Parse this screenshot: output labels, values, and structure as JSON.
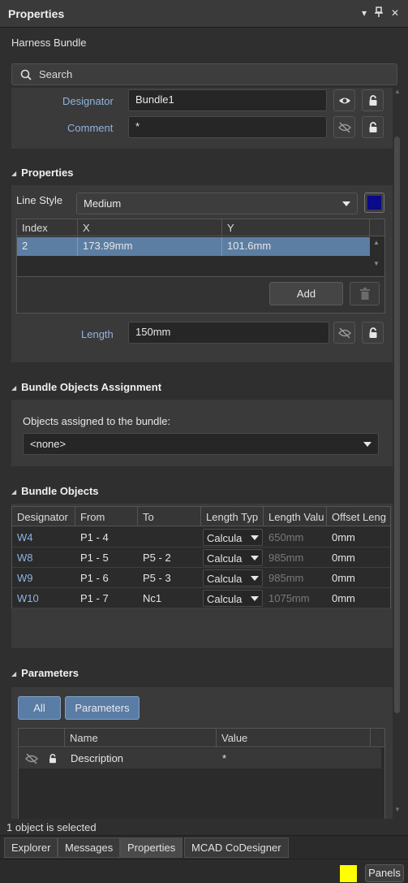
{
  "window": {
    "title": "Properties"
  },
  "subtitle": "Harness Bundle",
  "search": {
    "placeholder": "Search"
  },
  "general": {
    "designator_label": "Designator",
    "designator_value": "Bundle1",
    "comment_label": "Comment",
    "comment_value": "*"
  },
  "properties_section": {
    "title": "Properties",
    "line_style_label": "Line Style",
    "line_style_value": "Medium",
    "line_color": "#0a0a8a",
    "grid": {
      "headers": [
        "Index",
        "X",
        "Y"
      ],
      "rows": [
        {
          "index": "2",
          "x": "173.99mm",
          "y": "101.6mm"
        }
      ]
    },
    "add_label": "Add",
    "length_label": "Length",
    "length_value": "150mm"
  },
  "assignment_section": {
    "title": "Bundle Objects Assignment",
    "caption": "Objects assigned to the bundle:",
    "value": "<none>"
  },
  "objects_section": {
    "title": "Bundle Objects",
    "headers": [
      "Designator",
      "From",
      "To",
      "Length Typ",
      "Length Valu",
      "Offset Leng"
    ],
    "rows": [
      {
        "designator": "W4",
        "from": "P1 - 4",
        "to": "",
        "type": "Calcula",
        "length": "650mm",
        "offset": "0mm"
      },
      {
        "designator": "W8",
        "from": "P1 - 5",
        "to": "P5 - 2",
        "type": "Calcula",
        "length": "985mm",
        "offset": "0mm"
      },
      {
        "designator": "W9",
        "from": "P1 - 6",
        "to": "P5 - 3",
        "type": "Calcula",
        "length": "985mm",
        "offset": "0mm"
      },
      {
        "designator": "W10",
        "from": "P1 - 7",
        "to": "Nc1",
        "type": "Calcula",
        "length": "1075mm",
        "offset": "0mm"
      }
    ]
  },
  "parameters_section": {
    "title": "Parameters",
    "all_label": "All",
    "parameters_label": "Parameters",
    "headers": [
      "Name",
      "Value"
    ],
    "rows": [
      {
        "name": "Description",
        "value": "*"
      }
    ]
  },
  "status": "1 object is selected",
  "tabs": [
    "Explorer",
    "Messages",
    "Properties",
    "MCAD CoDesigner"
  ],
  "bottom": {
    "panels_label": "Panels",
    "indicator_color": "#ffff00"
  }
}
